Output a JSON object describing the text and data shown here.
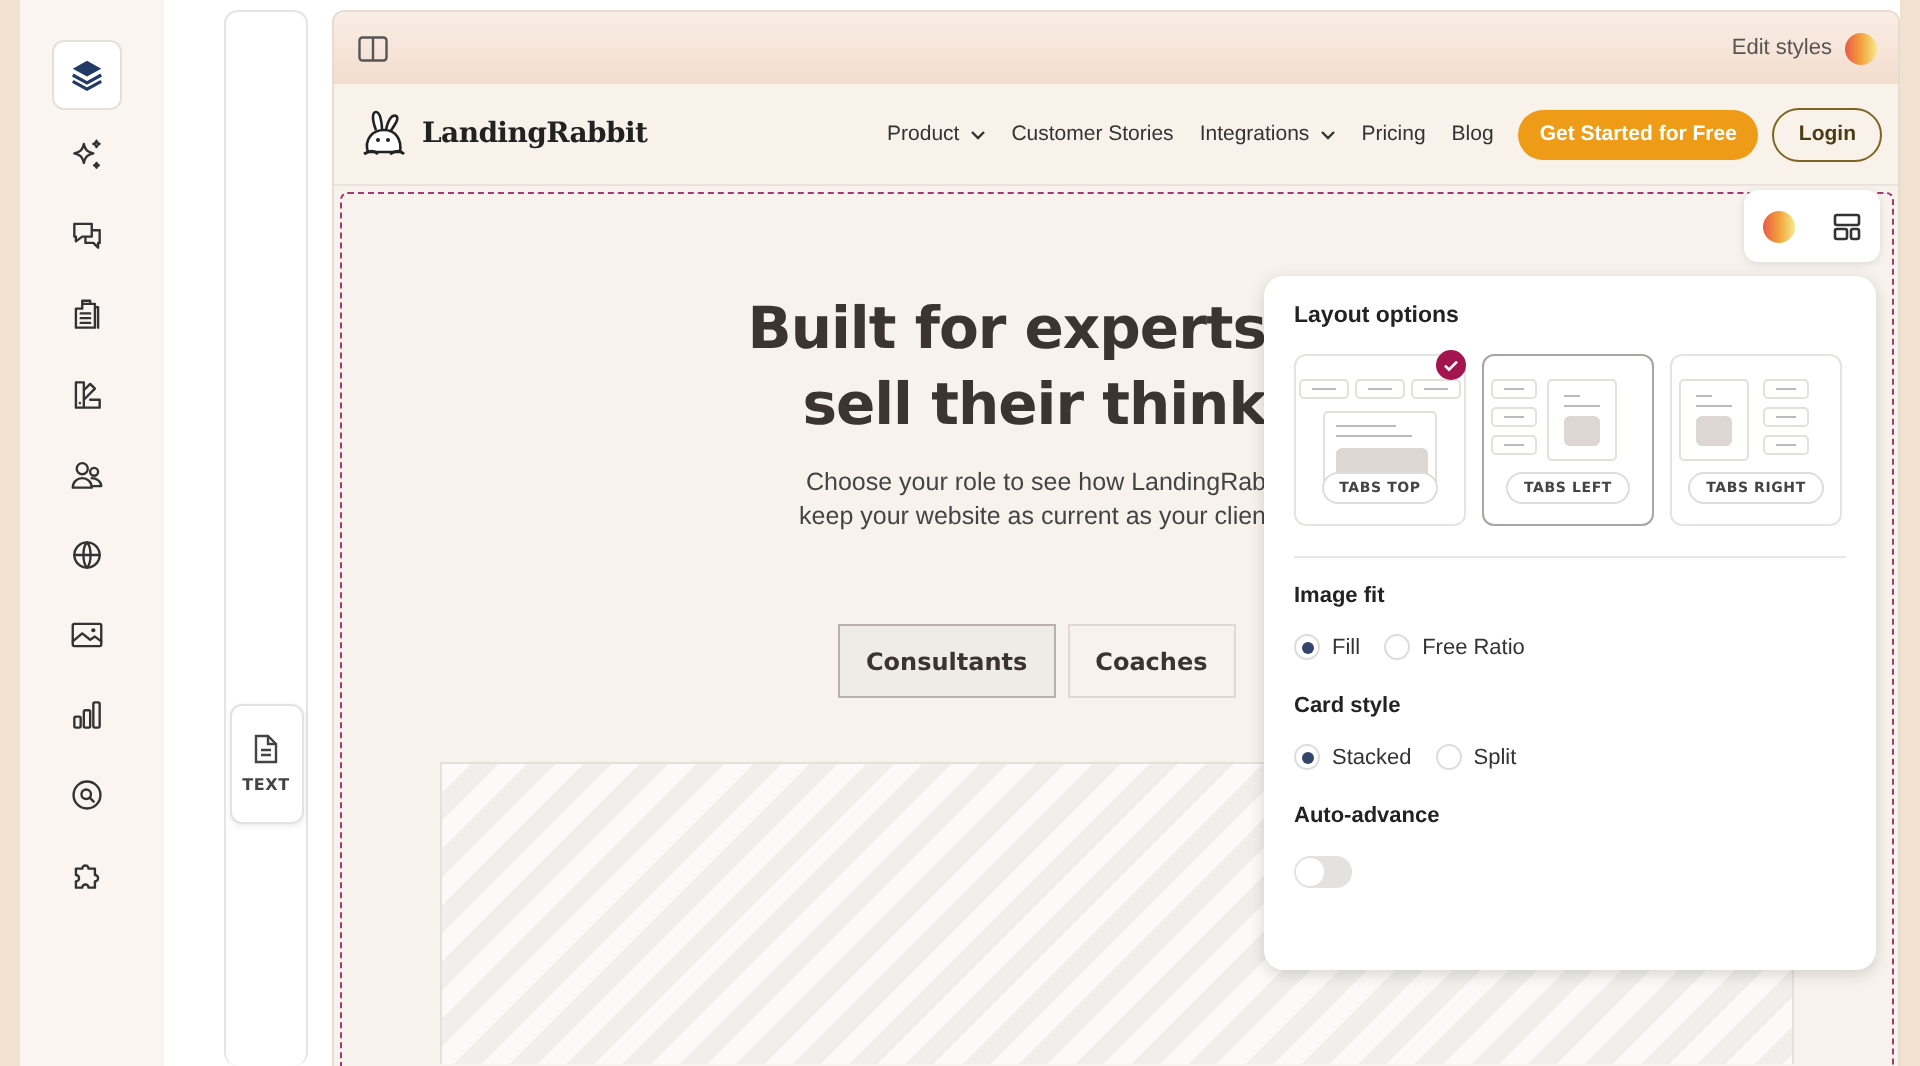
{
  "sidebar": {
    "items": [
      {
        "kind": "layers",
        "selected": true
      },
      {
        "kind": "sparkles",
        "selected": false
      },
      {
        "kind": "chat",
        "selected": false
      },
      {
        "kind": "clipboard",
        "selected": false
      },
      {
        "kind": "swatch",
        "selected": false
      },
      {
        "kind": "people",
        "selected": false
      },
      {
        "kind": "globe",
        "selected": false
      },
      {
        "kind": "image",
        "selected": false
      },
      {
        "kind": "chart",
        "selected": false
      },
      {
        "kind": "search",
        "selected": false
      },
      {
        "kind": "puzzle",
        "selected": false
      }
    ]
  },
  "block_palette": {
    "items": [
      {
        "label": "TEXT"
      }
    ]
  },
  "editor_bar": {
    "edit_styles": "Edit styles"
  },
  "site_nav": {
    "brand": "LandingRabbit",
    "links": [
      {
        "label": "Product",
        "dropdown": true
      },
      {
        "label": "Customer Stories",
        "dropdown": false
      },
      {
        "label": "Integrations",
        "dropdown": true
      },
      {
        "label": "Pricing",
        "dropdown": false
      },
      {
        "label": "Blog",
        "dropdown": false
      }
    ],
    "cta": "Get Started for Free",
    "login": "Login"
  },
  "hero": {
    "title_lines": [
      "Built for experts",
      "sell their think"
    ],
    "subtitle_lines": [
      "Choose your role to see how LandingRab",
      "keep your website as current as your clien"
    ],
    "tabs": [
      {
        "label": "Consultants",
        "selected": true
      },
      {
        "label": "Coaches",
        "selected": false
      }
    ]
  },
  "layout_panel": {
    "title": "Layout options",
    "layouts": [
      {
        "label": "TABS TOP",
        "kind": "top",
        "selected": true,
        "hovered": false
      },
      {
        "label": "TABS LEFT",
        "kind": "left",
        "selected": false,
        "hovered": true
      },
      {
        "label": "TABS RIGHT",
        "kind": "right",
        "selected": false,
        "hovered": false
      }
    ],
    "image_fit": {
      "label": "Image fit",
      "options": [
        {
          "label": "Fill",
          "selected": true
        },
        {
          "label": "Free Ratio",
          "selected": false
        }
      ]
    },
    "card_style": {
      "label": "Card style",
      "options": [
        {
          "label": "Stacked",
          "selected": true
        },
        {
          "label": "Split",
          "selected": false
        }
      ]
    },
    "auto_advance": {
      "label": "Auto-advance",
      "on": false
    }
  }
}
